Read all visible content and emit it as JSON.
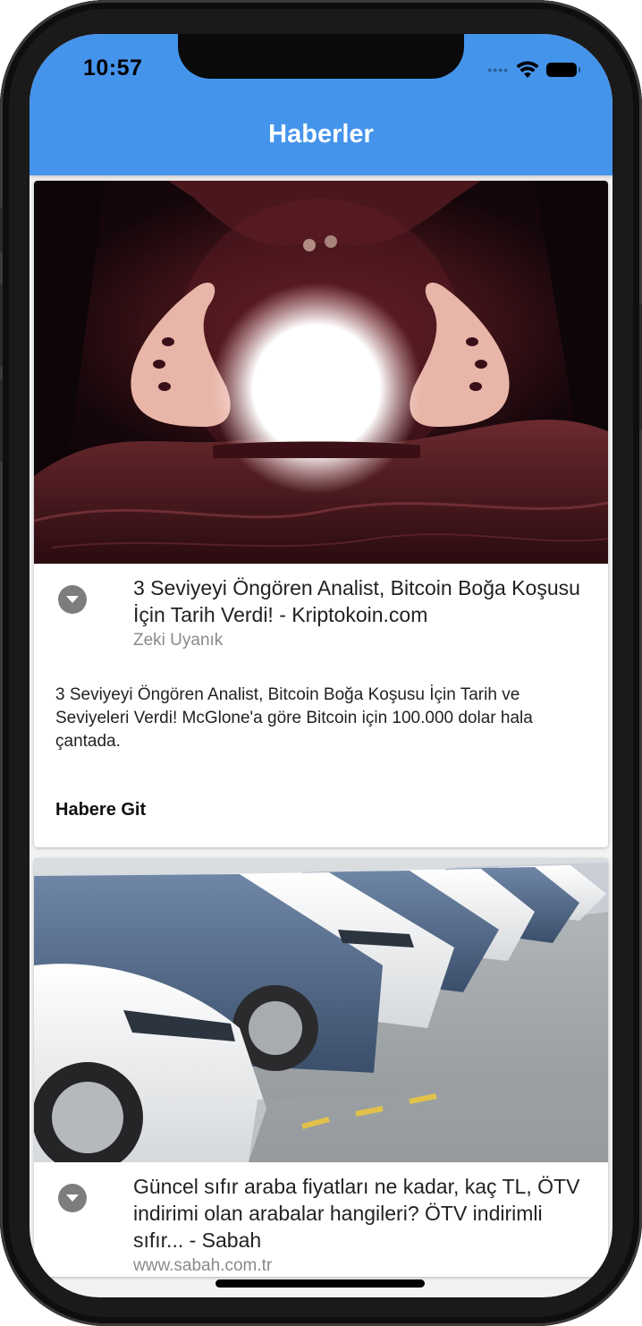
{
  "status_bar": {
    "time": "10:57"
  },
  "appbar": {
    "title": "Haberler"
  },
  "articles": [
    {
      "title": "3 Seviyeyi Öngören Analist, Bitcoin Boğa Koşusu İçin Tarih Verdi! - Kriptokoin.com",
      "subtitle": "Zeki Uyanık",
      "description": "3 Seviyeyi Öngören Analist, Bitcoin Boğa Koşusu İçin Tarih ve Seviyeleri Verdi! McGlone'a göre Bitcoin için 100.000 dolar hala çantada.",
      "action": "Habere Git",
      "image": "crystal-ball-photo"
    },
    {
      "title": "Güncel sıfır araba fiyatları ne kadar, kaç TL, ÖTV indirimi olan arabalar hangileri? ÖTV indirimli sıfır... - Sabah",
      "subtitle": "www.sabah.com.tr",
      "image": "parked-cars-photo"
    }
  ],
  "colors": {
    "appbar": "#4594ec",
    "title_text": "#ffffff",
    "expand_icon": "#7d7d7d"
  }
}
